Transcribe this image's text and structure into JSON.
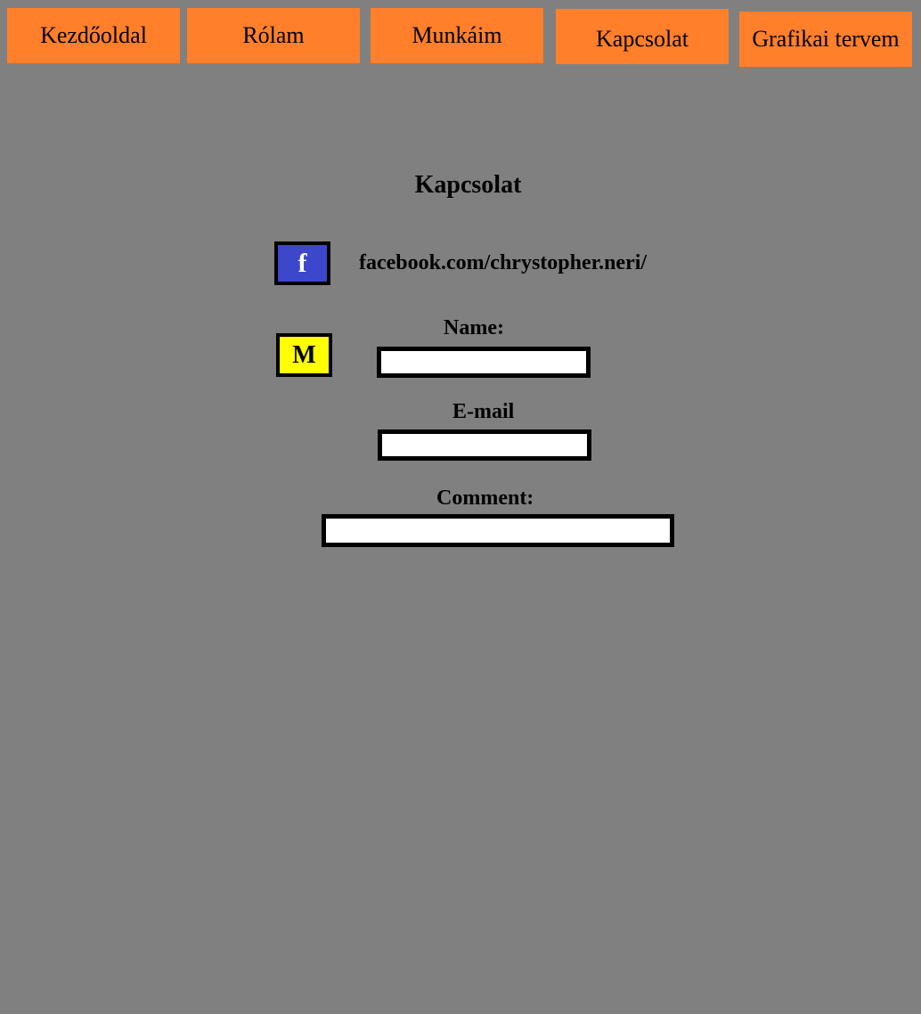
{
  "nav": {
    "home": "Kezdőoldal",
    "about": "Rólam",
    "works": "Munkáim",
    "contact": "Kapcsolat",
    "design": "Grafikai tervem"
  },
  "page": {
    "heading": "Kapcsolat"
  },
  "contact": {
    "facebook_icon_glyph": "f",
    "facebook_icon": "facebook-icon",
    "facebook_link": "facebook.com/chrystopher.neri/",
    "mail_icon_glyph": "M",
    "mail_icon": "mail-icon"
  },
  "form": {
    "name_label": "Name:",
    "name_value": "",
    "email_label": "E-mail",
    "email_value": "",
    "comment_label": "Comment:",
    "comment_value": ""
  },
  "colors": {
    "background": "#808080",
    "nav_button": "#ff7f2a",
    "facebook_blue": "#3c47cc",
    "mail_yellow": "#ffff00"
  }
}
